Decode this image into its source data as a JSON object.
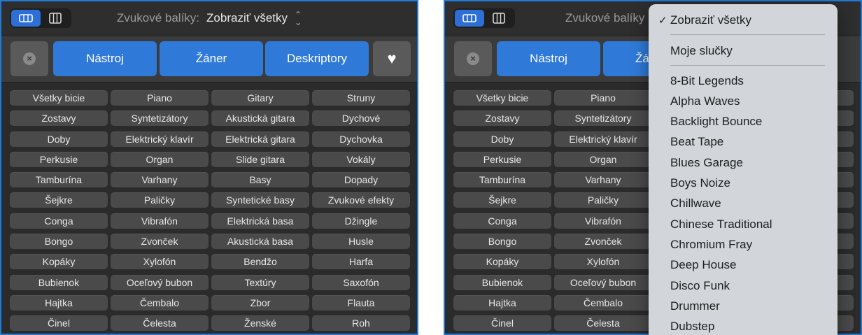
{
  "pack_selector": {
    "label": "Zvukové balíky:",
    "value": "Zobraziť všetky"
  },
  "filters": {
    "instrument": "Nástroj",
    "genre": "Žáner",
    "descriptors": "Deskriptory"
  },
  "keywords": [
    [
      "Všetky bicie",
      "Piano",
      "Gitary",
      "Struny"
    ],
    [
      "Zostavy",
      "Syntetizátory",
      "Akustická gitara",
      "Dychové"
    ],
    [
      "Doby",
      "Elektrický klavír",
      "Elektrická gitara",
      "Dychovka"
    ],
    [
      "Perkusie",
      "Organ",
      "Slide gitara",
      "Vokály"
    ],
    [
      "Tamburína",
      "Varhany",
      "Basy",
      "Dopady"
    ],
    [
      "Šejkre",
      "Paličky",
      "Syntetické basy",
      "Zvukové efekty"
    ],
    [
      "Conga",
      "Vibrafón",
      "Elektrická basa",
      "Džingle"
    ],
    [
      "Bongo",
      "Zvonček",
      "Akustická basa",
      "Husle"
    ],
    [
      "Kopáky",
      "Xylofón",
      "Bendžo",
      "Harfa"
    ],
    [
      "Bubienok",
      "Oceľový bubon",
      "Textúry",
      "Saxofón"
    ],
    [
      "Hajtka",
      "Čembalo",
      "Zbor",
      "Flauta"
    ],
    [
      "Činel",
      "Čelesta",
      "Ženské",
      "Roh"
    ]
  ],
  "right_partial": {
    "genre_fragment": "Žá",
    "pack_label_fragment": "Zvukové balíky"
  },
  "dropdown": {
    "checkmark": "✓",
    "show_all": "Zobraziť všetky",
    "my_loops": "Moje slučky",
    "packs": [
      "8-Bit Legends",
      "Alpha Waves",
      "Backlight Bounce",
      "Beat Tape",
      "Blues Garage",
      "Boys Noize",
      "Chillwave",
      "Chinese Traditional",
      "Chromium Fray",
      "Deep House",
      "Disco Funk",
      "Drummer",
      "Dubstep"
    ]
  },
  "colors": {
    "accent": "#2f7ad9",
    "panel_bg": "#2b2b2b",
    "border": "#1f7bd8",
    "menu_bg": "#d2d6db"
  }
}
